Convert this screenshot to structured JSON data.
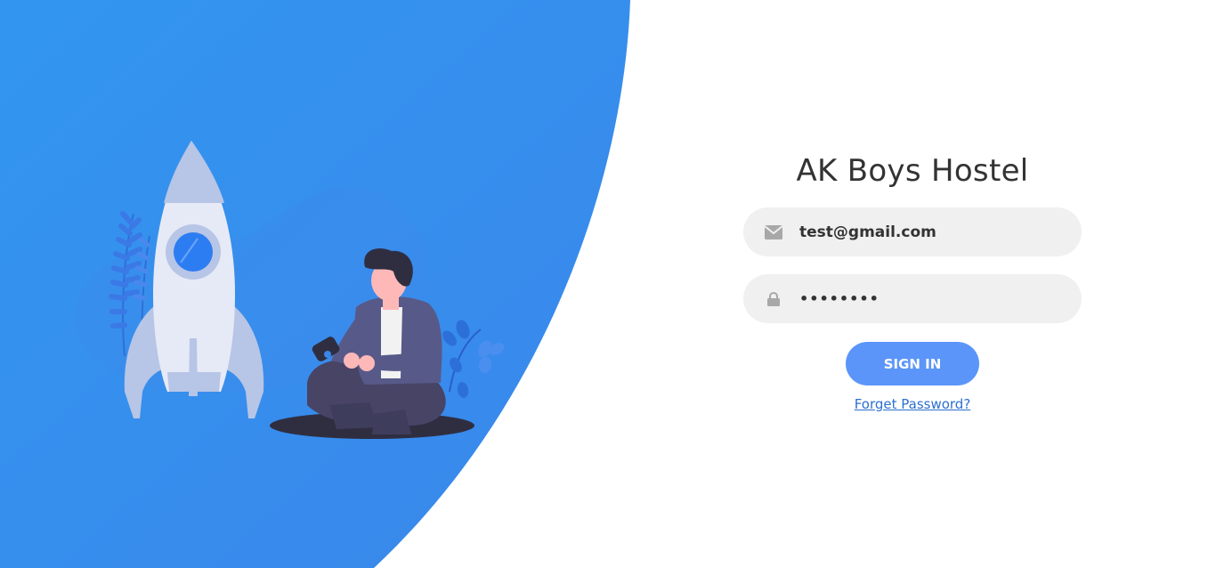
{
  "app": {
    "title": "AK Boys Hostel"
  },
  "login_form": {
    "email": {
      "value": "test@gmail.com",
      "icon": "envelope-icon"
    },
    "password": {
      "value": "••••••••",
      "icon": "lock-icon"
    },
    "sign_in_label": "SIGN IN",
    "forgot_password_label": "Forget Password?"
  },
  "colors": {
    "panel_blue": "#3a8cee",
    "button_blue": "#5b95f9",
    "field_bg": "#f0f0f0",
    "link_blue": "#2d6fcf",
    "title_text": "#333333"
  },
  "illustration": {
    "icons": [
      "rocket-illustration",
      "person-illustration",
      "plant-illustration"
    ]
  }
}
